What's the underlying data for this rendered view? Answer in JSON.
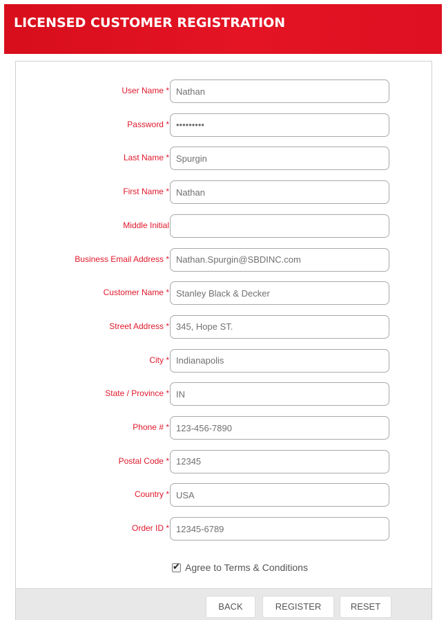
{
  "header": {
    "title": "LICENSED CUSTOMER REGISTRATION",
    "background_color": "#e01424"
  },
  "form": {
    "label_color": "#e0182b",
    "fields": [
      {
        "key": "user_name",
        "label": "User Name *",
        "value": "Nathan",
        "type": "text"
      },
      {
        "key": "password",
        "label": "Password *",
        "value": "•••••••••",
        "type": "text"
      },
      {
        "key": "last_name",
        "label": "Last Name *",
        "value": "Spurgin",
        "type": "text"
      },
      {
        "key": "first_name",
        "label": "First Name *",
        "value": "Nathan",
        "type": "text"
      },
      {
        "key": "middle_initial",
        "label": "Middle Initial",
        "value": "",
        "type": "text"
      },
      {
        "key": "business_email",
        "label": "Business Email Address *",
        "value": "Nathan.Spurgin@SBDINC.com",
        "type": "text"
      },
      {
        "key": "customer_name",
        "label": "Customer Name *",
        "value": "Stanley Black & Decker",
        "type": "text"
      },
      {
        "key": "street_address",
        "label": "Street Address *",
        "value": "345, Hope ST.",
        "type": "text"
      },
      {
        "key": "city",
        "label": "City *",
        "value": "Indianapolis",
        "type": "text"
      },
      {
        "key": "state_province",
        "label": "State / Province *",
        "value": "IN",
        "type": "text"
      },
      {
        "key": "phone",
        "label": "Phone # *",
        "value": "123-456-7890",
        "type": "text"
      },
      {
        "key": "postal_code",
        "label": "Postal Code *",
        "value": "12345",
        "type": "text"
      },
      {
        "key": "country",
        "label": "Country *",
        "value": "USA",
        "type": "text"
      },
      {
        "key": "order_id",
        "label": "Order ID *",
        "value": "12345-6789",
        "type": "text"
      }
    ],
    "agree": {
      "label": "Agree to Terms & Conditions",
      "checked": true
    }
  },
  "footer": {
    "back_label": "BACK",
    "register_label": "REGISTER",
    "reset_label": "RESET"
  }
}
